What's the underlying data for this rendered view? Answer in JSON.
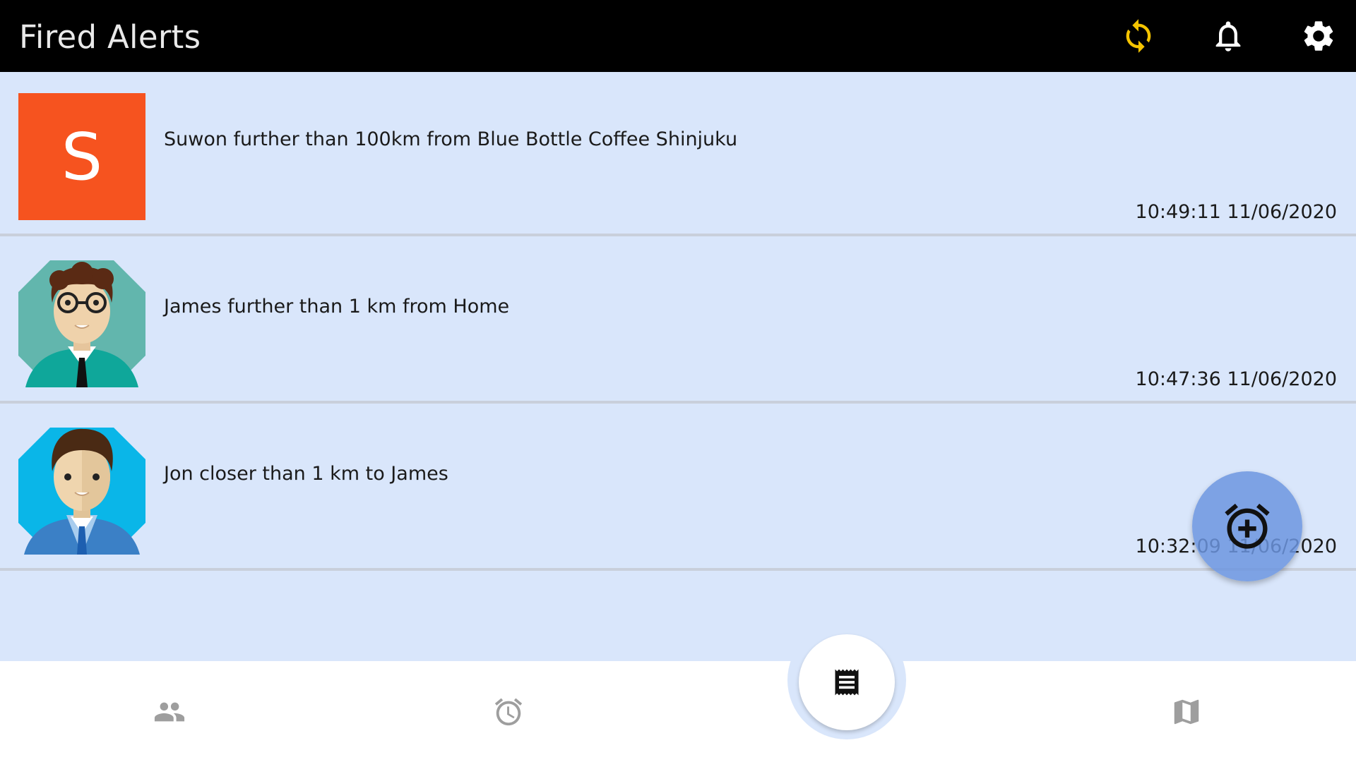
{
  "header": {
    "title": "Fired Alerts",
    "icons": [
      "sync-icon",
      "bell-icon",
      "gear-icon"
    ],
    "sync_color": "#f5c400"
  },
  "alerts": [
    {
      "avatar_letter": "S",
      "avatar_color": "#f6531f",
      "message": "Suwon further than 100km from Blue Bottle Coffee Shinjuku",
      "timestamp": "10:49:11 11/06/2020"
    },
    {
      "avatar": "man-glasses-avatar",
      "message": "James further than 1 km from Home",
      "timestamp": "10:47:36 11/06/2020"
    },
    {
      "avatar": "man-suit-avatar",
      "message": "Jon closer than 1 km to James",
      "timestamp": "10:32:09 11/06/2020"
    }
  ],
  "fab": {
    "icon": "add-alarm-icon"
  },
  "bottom_nav": {
    "items": [
      "people-icon",
      "alarm-icon",
      "receipt-icon",
      "map-icon"
    ],
    "active": "receipt-icon"
  }
}
